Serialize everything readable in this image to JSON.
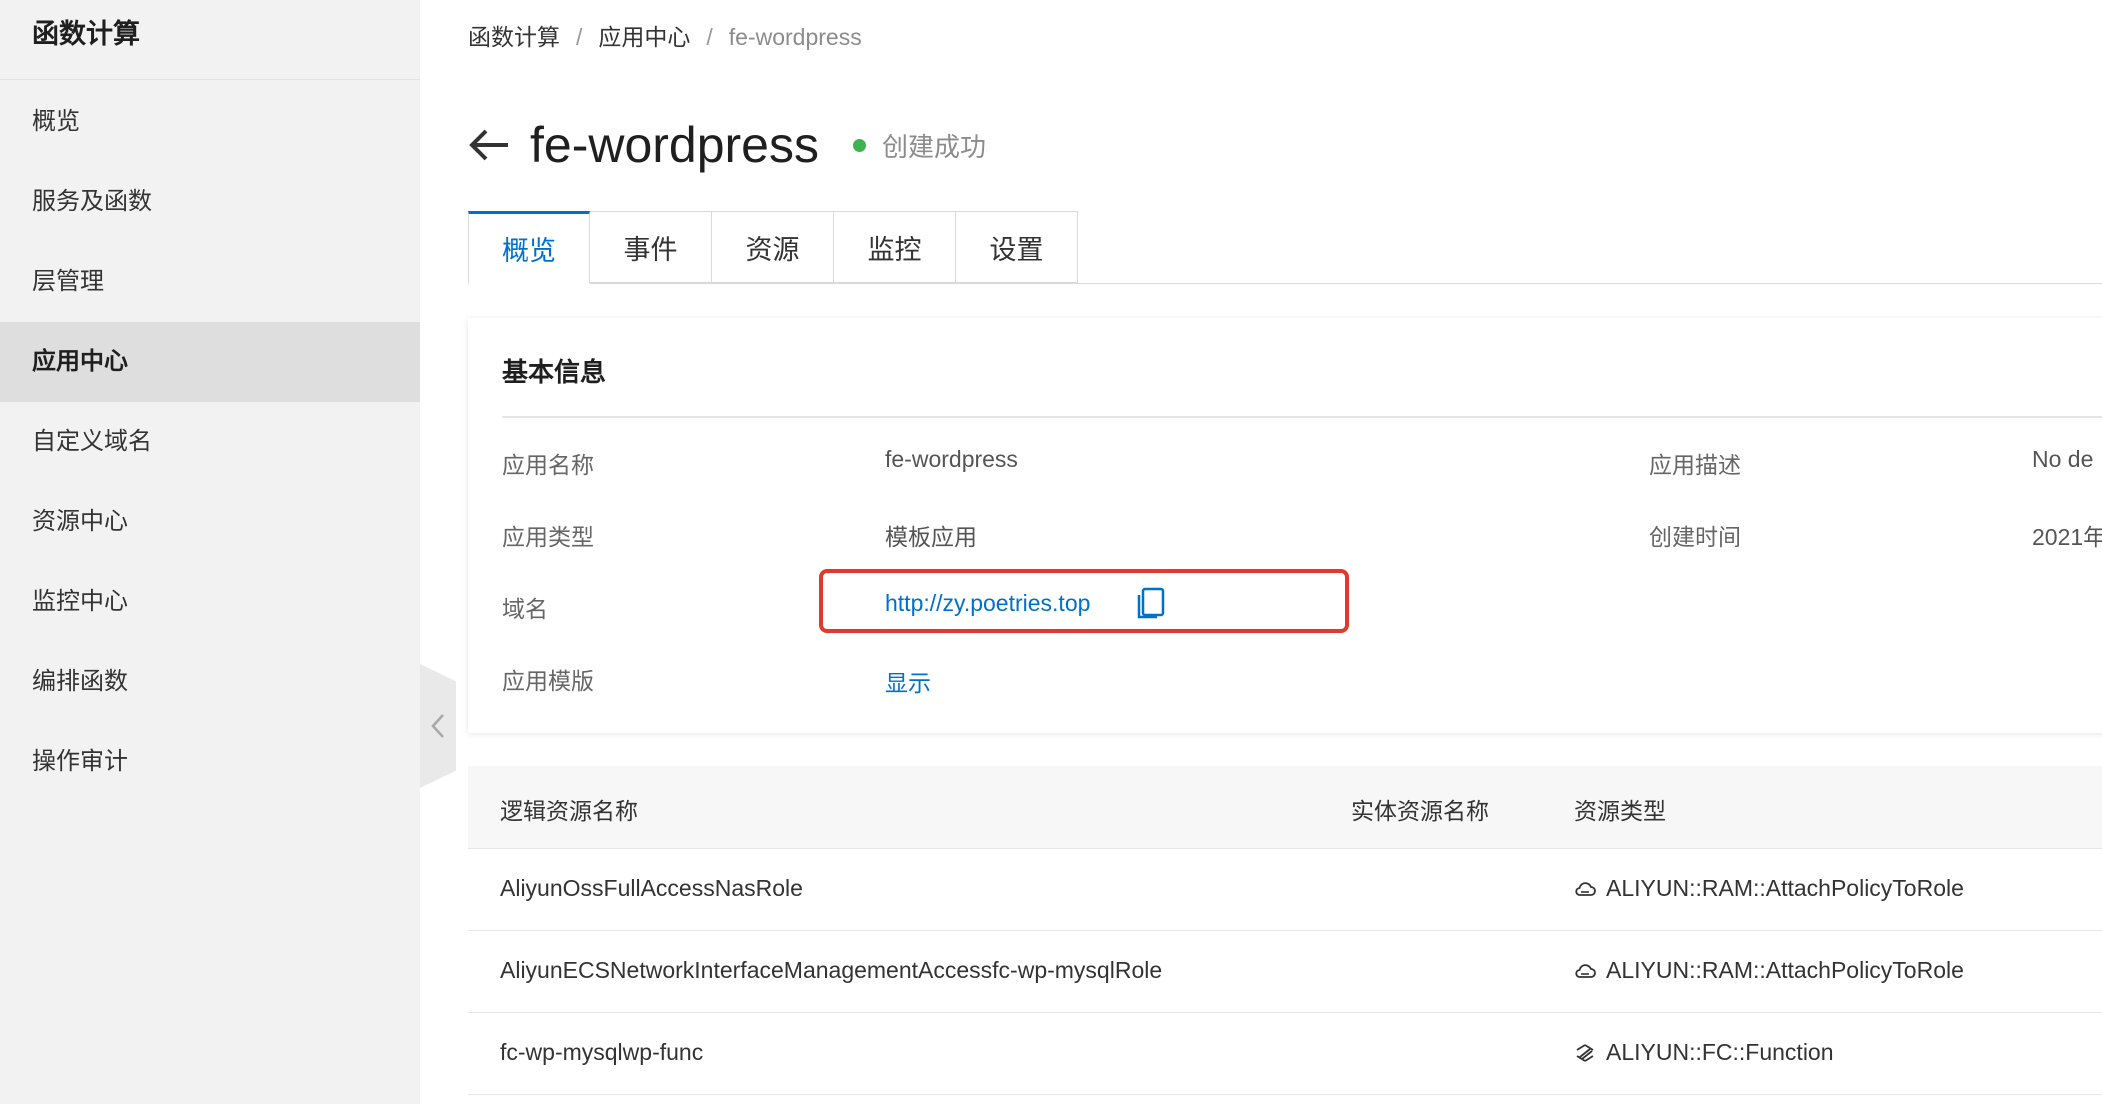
{
  "sidebar": {
    "title": "函数计算",
    "items": [
      {
        "label": "概览"
      },
      {
        "label": "服务及函数"
      },
      {
        "label": "层管理"
      },
      {
        "label": "应用中心",
        "active": true
      },
      {
        "label": "自定义域名"
      },
      {
        "label": "资源中心"
      },
      {
        "label": "监控中心"
      },
      {
        "label": "编排函数"
      },
      {
        "label": "操作审计"
      }
    ]
  },
  "breadcrumb": [
    "函数计算",
    "应用中心",
    "fe-wordpress"
  ],
  "breadcrumb_separator": "/",
  "header": {
    "title": "fe-wordpress",
    "status": "创建成功",
    "status_color": "#3fb34f"
  },
  "tabs": [
    {
      "label": "概览",
      "active": true
    },
    {
      "label": "事件"
    },
    {
      "label": "资源"
    },
    {
      "label": "监控"
    },
    {
      "label": "设置"
    }
  ],
  "basic_info": {
    "title": "基本信息",
    "app_name_label": "应用名称",
    "app_name": "fe-wordpress",
    "app_type_label": "应用类型",
    "app_type": "模板应用",
    "domain_label": "域名",
    "domain": "http://zy.poetries.top",
    "template_label": "应用模版",
    "template_action": "显示",
    "description_label": "应用描述",
    "description": "No de",
    "created_label": "创建时间",
    "created": "2021年"
  },
  "resource_table": {
    "columns": [
      "逻辑资源名称",
      "实体资源名称",
      "资源类型"
    ],
    "rows": [
      {
        "logical": "AliyunOssFullAccessNasRole",
        "physical": "",
        "type": "ALIYUN::RAM::AttachPolicyToRole",
        "icon": "cloud-icon"
      },
      {
        "logical": "AliyunECSNetworkInterfaceManagementAccessfc-wp-mysqlRole",
        "physical": "",
        "type": "ALIYUN::RAM::AttachPolicyToRole",
        "icon": "cloud-icon"
      },
      {
        "logical": "fc-wp-mysqlwp-func",
        "physical": "",
        "type": "ALIYUN::FC::Function",
        "icon": "function-icon"
      }
    ]
  },
  "colors": {
    "accent": "#0070cc",
    "highlight_border": "#e03a2a",
    "sidebar_bg": "#f2f2f2"
  }
}
